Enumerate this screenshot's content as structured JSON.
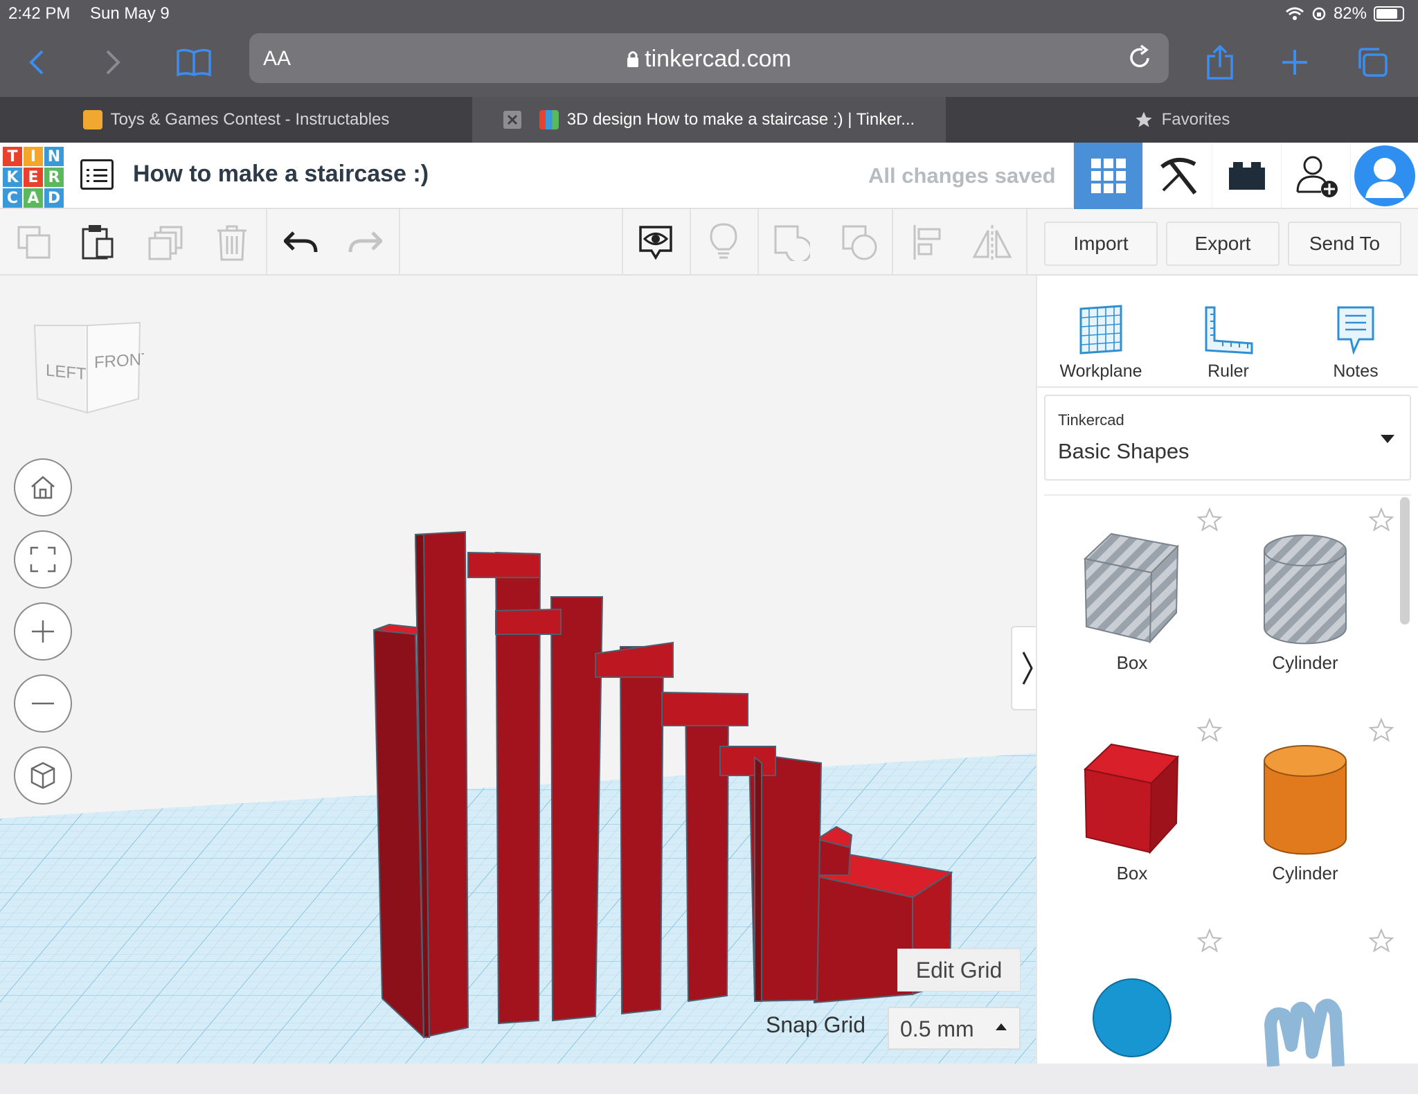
{
  "status": {
    "time": "2:42 PM",
    "date": "Sun May 9",
    "battery": "82%",
    "battery_level": 0.82
  },
  "browser": {
    "text_size_label": "AA",
    "url": "tinkercad.com"
  },
  "tabs": [
    {
      "title": "Toys & Games Contest - Instructables"
    },
    {
      "title": "3D design How to make a staircase :) | Tinker..."
    },
    {
      "title": "Favorites"
    }
  ],
  "header": {
    "logo_letters": [
      "T",
      "I",
      "N",
      "K",
      "E",
      "R",
      "C",
      "A",
      "D"
    ],
    "logo_colors": [
      "#e8412e",
      "#f4a62a",
      "#3a9ad9",
      "#3a9ad9",
      "#e8412e",
      "#5cb85c",
      "#3a9ad9",
      "#5cb85c",
      "#3a9ad9"
    ],
    "design_title": "How to make a staircase :)",
    "save_status": "All changes saved"
  },
  "toolbar": {
    "import": "Import",
    "export": "Export",
    "send_to": "Send To"
  },
  "viewcube": {
    "left": "LEFT",
    "front": "FRONT"
  },
  "grid": {
    "edit_grid": "Edit Grid",
    "snap_label": "Snap Grid",
    "snap_value": "0.5 mm"
  },
  "panel": {
    "tools": [
      {
        "label": "Workplane"
      },
      {
        "label": "Ruler"
      },
      {
        "label": "Notes"
      }
    ],
    "category": {
      "source": "Tinkercad",
      "name": "Basic Shapes"
    },
    "shapes": [
      {
        "label": "Box"
      },
      {
        "label": "Cylinder"
      },
      {
        "label": "Box"
      },
      {
        "label": "Cylinder"
      },
      {
        "label": ""
      },
      {
        "label": ""
      }
    ]
  },
  "colors": {
    "accent": "#4a90d9",
    "model_red": "#b0151f",
    "workplane": "#d6ecf7"
  }
}
